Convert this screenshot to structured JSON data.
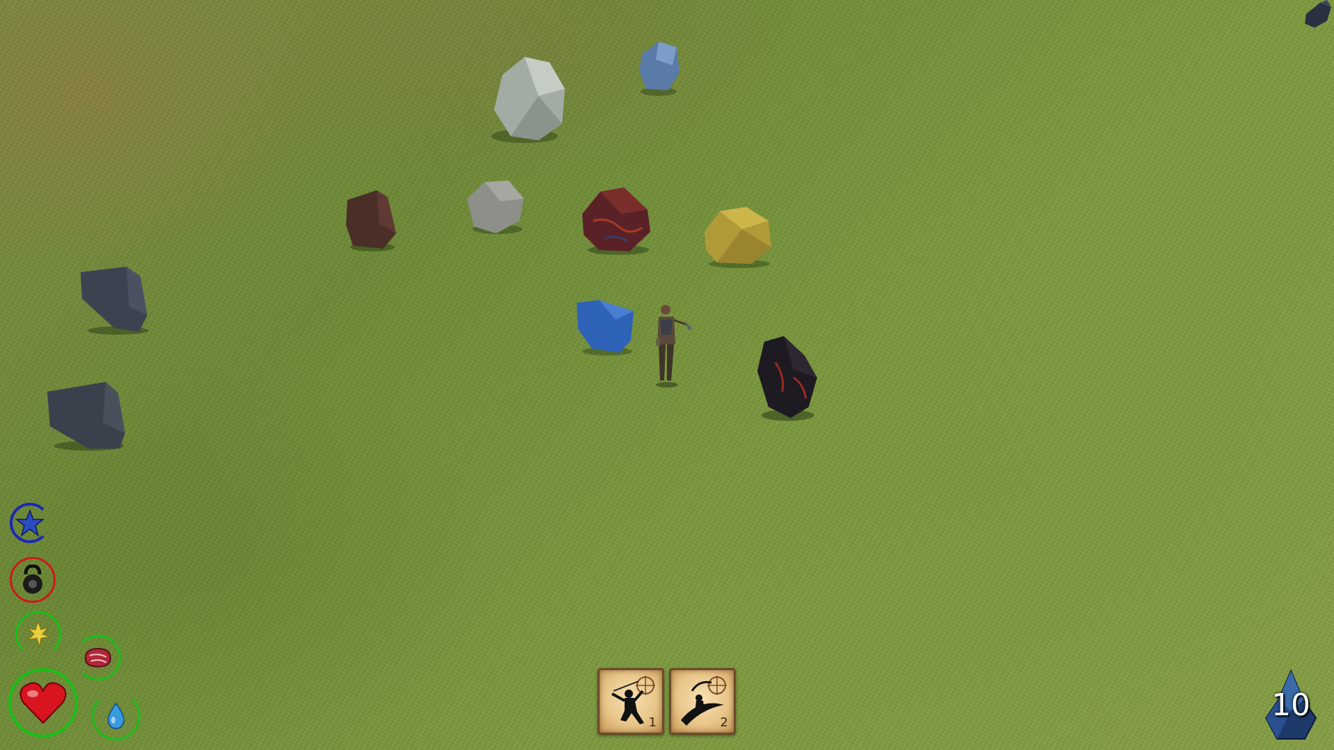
{
  "scene": {
    "ground": "grass field",
    "rocks": [
      {
        "name": "light-gray-boulder",
        "color": "#9aa49a"
      },
      {
        "name": "blue-gray-boulder",
        "color": "#5a7aa8"
      },
      {
        "name": "brown-ore-rock",
        "color": "#4a2e28"
      },
      {
        "name": "gray-stone-rock",
        "color": "#8c9088"
      },
      {
        "name": "red-ore-rock",
        "color": "#6a2a2a"
      },
      {
        "name": "gold-ore-rock",
        "color": "#b09a38"
      },
      {
        "name": "slate-rock-left-upper",
        "color": "#3c4250"
      },
      {
        "name": "slate-rock-left-lower",
        "color": "#3a414c"
      },
      {
        "name": "blue-crystal-rock",
        "color": "#2f63b8"
      },
      {
        "name": "obsidian-lava-rock",
        "color": "#2a1e24"
      }
    ],
    "player": "miner-with-pickaxe"
  },
  "hud": {
    "stats": [
      {
        "name": "experience",
        "icon": "star-icon",
        "ring_color": "#1a28b8"
      },
      {
        "name": "strength",
        "icon": "kettlebell-icon",
        "ring_color": "#d01818"
      },
      {
        "name": "energy",
        "icon": "energy-spark-icon",
        "ring_color": "#18c018"
      },
      {
        "name": "hunger",
        "icon": "meat-icon",
        "ring_color": "#18c018"
      },
      {
        "name": "health",
        "icon": "heart-icon",
        "ring_color": "#18c018"
      },
      {
        "name": "thirst",
        "icon": "water-drop-icon",
        "ring_color": "#18c018"
      }
    ],
    "hotbar": [
      {
        "slot": "1",
        "skill_icon": "sword-stance-skill-icon"
      },
      {
        "slot": "2",
        "skill_icon": "spin-slash-skill-icon"
      }
    ],
    "level": "10"
  }
}
